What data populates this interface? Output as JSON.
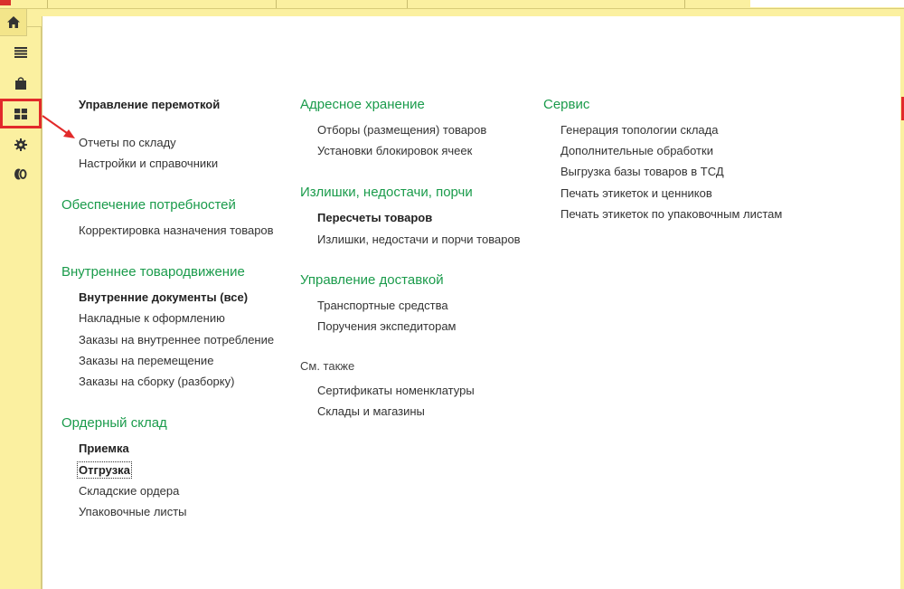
{
  "sidebar": {
    "items": [
      {
        "name": "home",
        "icon": "home-icon"
      },
      {
        "name": "menu",
        "icon": "menu-list-icon"
      },
      {
        "name": "bag",
        "icon": "shopping-bag-icon"
      },
      {
        "name": "warehouse",
        "icon": "grid-tiles-icon"
      },
      {
        "name": "settings",
        "icon": "gear-icon"
      },
      {
        "name": "coins",
        "icon": "coins-icon"
      }
    ]
  },
  "columns": {
    "col1": {
      "top_link": "Управление перемоткой",
      "top_items": [
        "Отчеты по складу",
        "Настройки и справочники"
      ],
      "group1": {
        "title": "Обеспечение потребностей",
        "items": [
          "Корректировка назначения товаров"
        ]
      },
      "group2": {
        "title": "Внутреннее товародвижение",
        "items": [
          "Внутренние документы (все)",
          "Накладные к оформлению",
          "Заказы на внутреннее потребление",
          "Заказы на перемещение",
          "Заказы на сборку (разборку)"
        ]
      },
      "group3": {
        "title": "Ордерный склад",
        "items": [
          "Приемка",
          "Отгрузка",
          "Складские ордера",
          "Упаковочные листы"
        ]
      }
    },
    "col2": {
      "group1": {
        "title": "Адресное хранение",
        "items": [
          "Отборы (размещения) товаров",
          "Установки блокировок ячеек"
        ]
      },
      "group2": {
        "title": "Излишки, недостачи, порчи",
        "items": [
          "Пересчеты товаров",
          "Излишки, недостачи и порчи товаров"
        ]
      },
      "group3": {
        "title": "Управление доставкой",
        "items": [
          "Транспортные средства",
          "Поручения экспедиторам"
        ]
      },
      "see_also": {
        "title": "См. также",
        "items": [
          "Сертификаты номенклатуры",
          "Склады и магазины"
        ]
      }
    },
    "col3": {
      "group1": {
        "title": "Сервис",
        "items": [
          "Генерация топологии склада",
          "Дополнительные обработки",
          "Выгрузка базы товаров в ТСД",
          "Печать этикеток и ценников",
          "Печать этикеток по упаковочным листам"
        ]
      }
    }
  },
  "colors": {
    "accent_green": "#1a9b4b",
    "sidebar_yellow": "#fbf0a0",
    "annotation_red": "#e22a2a"
  }
}
